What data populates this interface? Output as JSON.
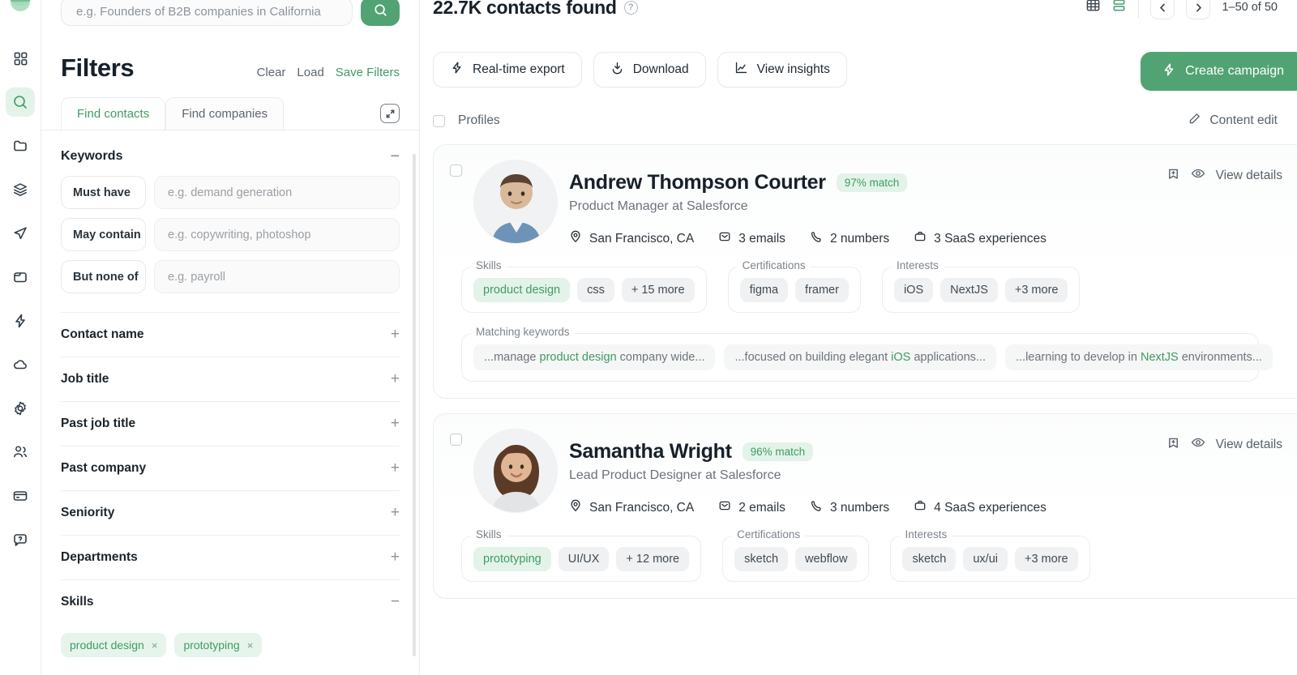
{
  "sidebar": {
    "logo": "logo-mark",
    "items": [
      {
        "icon": "grid-icon",
        "name": "dashboard",
        "active": false
      },
      {
        "icon": "search-icon",
        "name": "search",
        "active": true
      },
      {
        "icon": "folder-icon",
        "name": "lists",
        "active": false
      },
      {
        "icon": "layers-icon",
        "name": "data",
        "active": false
      },
      {
        "icon": "send-icon",
        "name": "campaigns",
        "active": false
      },
      {
        "icon": "folder-2-icon",
        "name": "files",
        "active": false
      },
      {
        "icon": "bolt-icon",
        "name": "automations",
        "active": false
      },
      {
        "icon": "cloud-icon",
        "name": "integrations",
        "active": false
      },
      {
        "icon": "gear-icon",
        "name": "settings",
        "active": false
      },
      {
        "icon": "users-icon",
        "name": "team",
        "active": false
      },
      {
        "icon": "card-icon",
        "name": "billing",
        "active": false
      },
      {
        "icon": "help-chat-icon",
        "name": "support",
        "active": false
      }
    ]
  },
  "search": {
    "placeholder": "e.g. Founders of B2B companies in California",
    "value": "",
    "button_icon": "search-icon"
  },
  "filters": {
    "title": "Filters",
    "clear_label": "Clear",
    "load_label": "Load",
    "save_label": "Save Filters",
    "tabs": [
      {
        "label": "Find contacts",
        "active": true
      },
      {
        "label": "Find companies",
        "active": false
      }
    ],
    "expand_icon": "expand-icon",
    "keywords": {
      "title": "Keywords",
      "toggle": "−",
      "rows": [
        {
          "label": "Must have",
          "placeholder": "e.g. demand generation",
          "value": ""
        },
        {
          "label": "May contain",
          "placeholder": "e.g. copywriting, photoshop",
          "value": ""
        },
        {
          "label": "But none of",
          "placeholder": "e.g. payroll",
          "value": ""
        }
      ]
    },
    "sections": [
      {
        "label": "Contact name",
        "toggle": "+"
      },
      {
        "label": "Job title",
        "toggle": "+"
      },
      {
        "label": "Past job title",
        "toggle": "+"
      },
      {
        "label": "Past company",
        "toggle": "+"
      },
      {
        "label": "Seniority",
        "toggle": "+"
      },
      {
        "label": "Departments",
        "toggle": "+"
      }
    ],
    "skills": {
      "label": "Skills",
      "toggle": "−",
      "chips": [
        {
          "label": "product design",
          "remove": "×"
        },
        {
          "label": "prototyping",
          "remove": "×"
        }
      ]
    }
  },
  "main": {
    "count_text": "22.7K contacts found",
    "help_icon": "question-icon",
    "view_toggle": [
      {
        "icon": "grid-view-icon",
        "active": false
      },
      {
        "icon": "list-view-icon",
        "active": true
      }
    ],
    "pagination": {
      "prev_icon": "chevron-left-icon",
      "next_icon": "chevron-right-icon",
      "range_text": "1–50 of 50"
    },
    "actions": [
      {
        "label": "Real-time export",
        "icon": "bolt-icon"
      },
      {
        "label": "Download",
        "icon": "download-icon"
      },
      {
        "label": "View insights",
        "icon": "chart-line-icon"
      }
    ],
    "cta": {
      "label": "Create campaign",
      "icon": "bolt-icon"
    },
    "profiles_label": "Profiles",
    "content_edit": {
      "label": "Content edit",
      "icon": "pencil-icon"
    },
    "group_labels": {
      "skills": "Skills",
      "certifications": "Certifications",
      "interests": "Interests",
      "matching_keywords": "Matching keywords"
    },
    "view_details_label": "View details",
    "profiles": [
      {
        "name": "Andrew Thompson Courter",
        "match": "97% match",
        "title": "Product Manager at Salesforce",
        "location": "San Francisco, CA",
        "emails": "3 emails",
        "numbers": "2 numbers",
        "experiences": "3 SaaS experiences",
        "avatar": "male-photo",
        "skills": [
          {
            "label": "product design",
            "highlight": true
          },
          {
            "label": "css",
            "highlight": false
          },
          {
            "label": "+ 15 more",
            "highlight": false
          }
        ],
        "certifications": [
          {
            "label": "figma",
            "highlight": false
          },
          {
            "label": "framer",
            "highlight": false
          }
        ],
        "interests": [
          {
            "label": "iOS",
            "highlight": false
          },
          {
            "label": "NextJS",
            "highlight": false
          },
          {
            "label": "+3 more",
            "highlight": false
          }
        ],
        "keywords": [
          {
            "pre": "...manage ",
            "hl": "product design",
            "post": " company wide..."
          },
          {
            "pre": "...focused on building elegant ",
            "hl": "iOS",
            "post": " applications..."
          },
          {
            "pre": "...learning to develop in ",
            "hl": "NextJS",
            "post": " environments..."
          }
        ]
      },
      {
        "name": "Samantha Wright",
        "match": "96% match",
        "title": "Lead Product Designer at Salesforce",
        "location": "San Francisco, CA",
        "emails": "2 emails",
        "numbers": "3 numbers",
        "experiences": "4 SaaS experiences",
        "avatar": "female-photo",
        "skills": [
          {
            "label": "prototyping",
            "highlight": true
          },
          {
            "label": "UI/UX",
            "highlight": false
          },
          {
            "label": "+ 12 more",
            "highlight": false
          }
        ],
        "certifications": [
          {
            "label": "sketch",
            "highlight": false
          },
          {
            "label": "webflow",
            "highlight": false
          }
        ],
        "interests": [
          {
            "label": "sketch",
            "highlight": false
          },
          {
            "label": "ux/ui",
            "highlight": false
          },
          {
            "label": "+3 more",
            "highlight": false
          }
        ],
        "keywords": []
      }
    ]
  },
  "colors": {
    "accent": "#52a373",
    "accent_text": "#3f9c63",
    "accent_bg": "#e3f3e9",
    "text": "#17202a",
    "muted": "#6a737c",
    "border": "#ededed"
  }
}
